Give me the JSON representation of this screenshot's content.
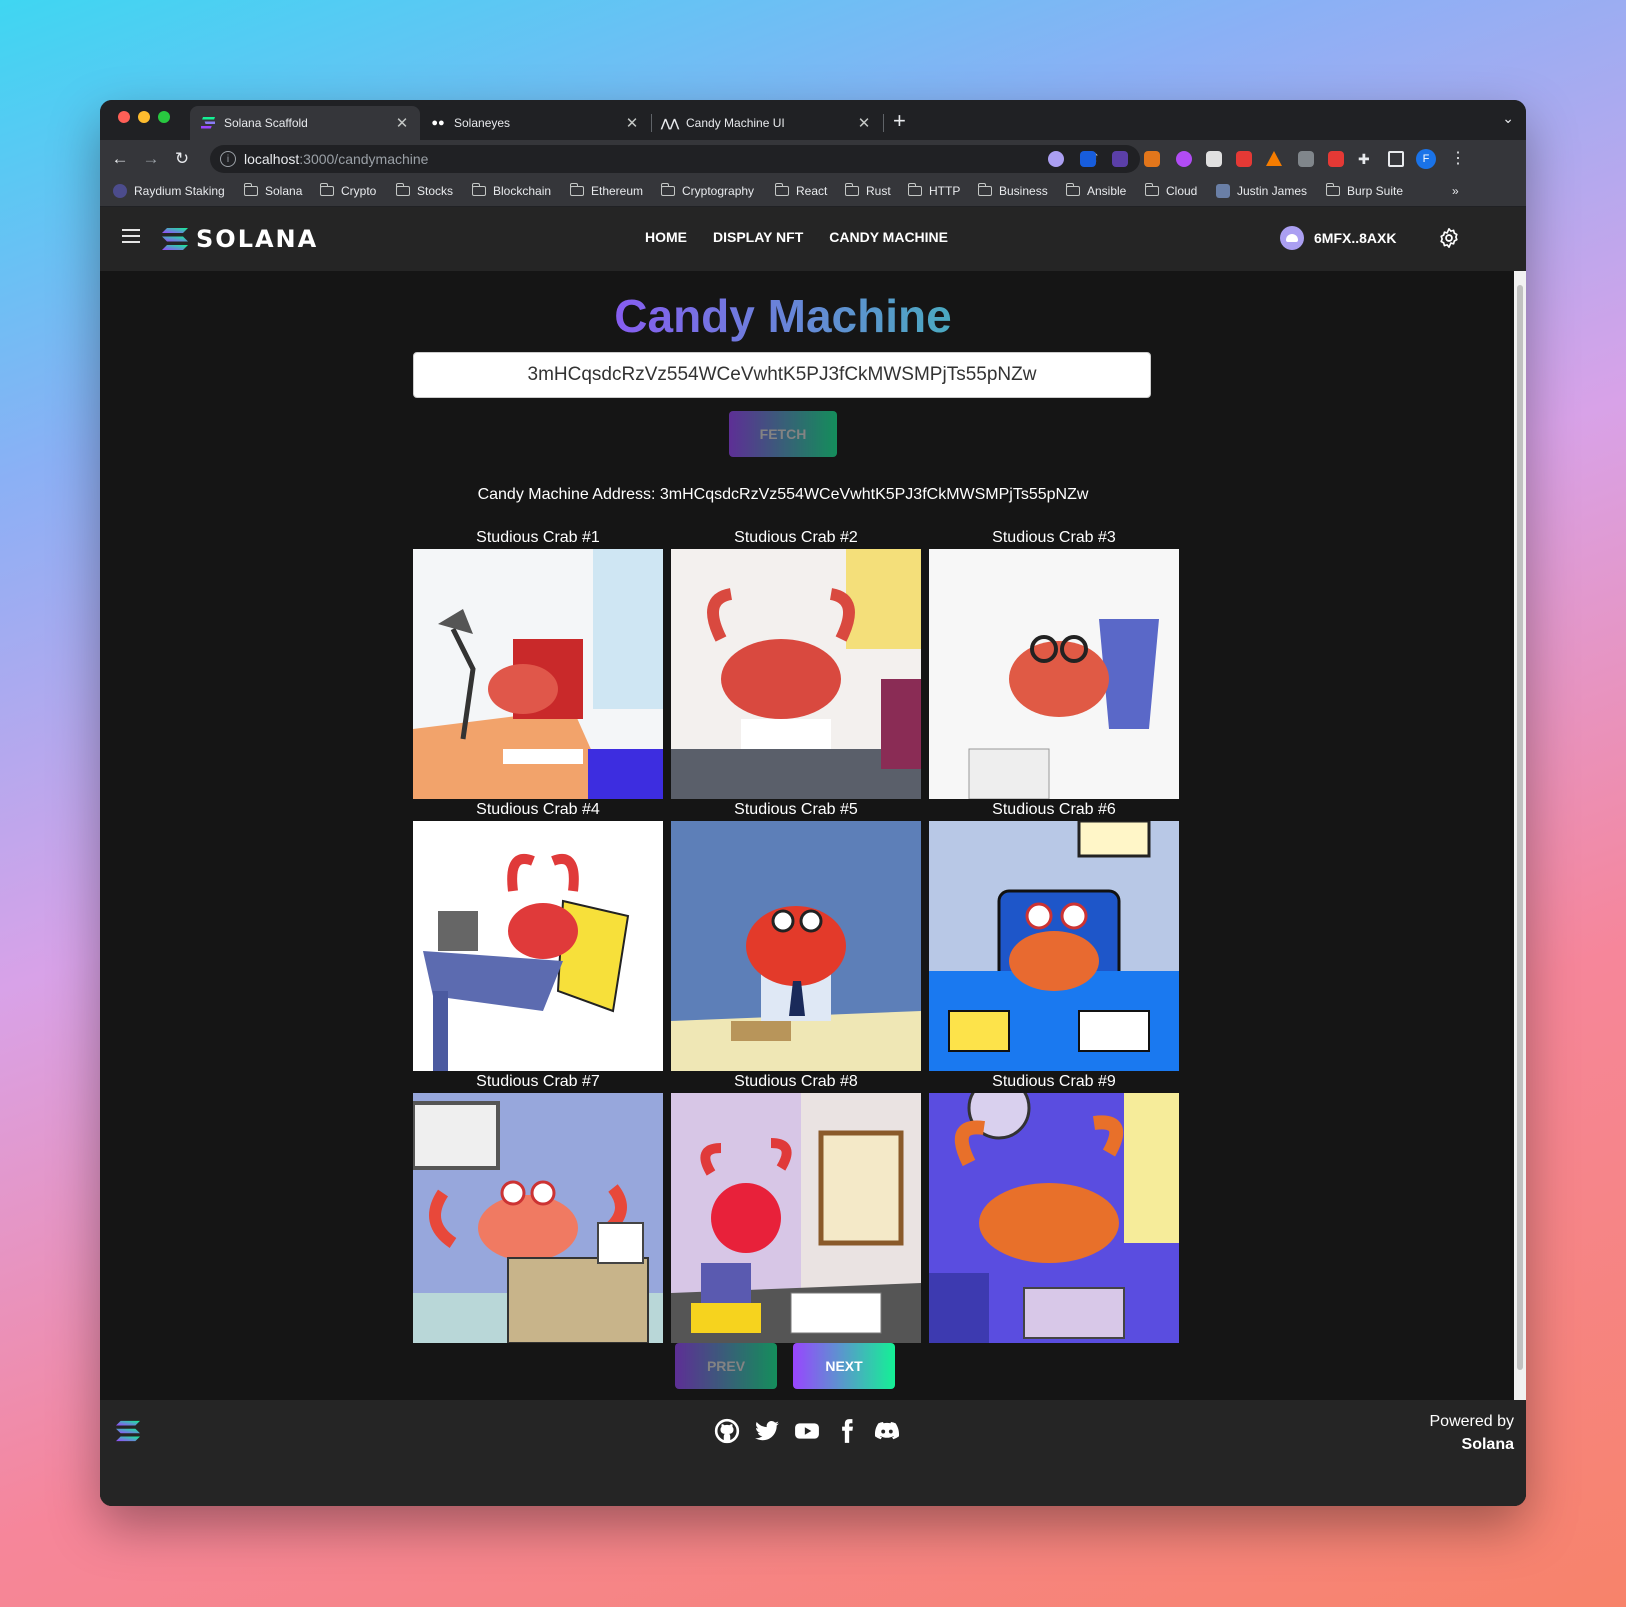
{
  "browser": {
    "tabs": [
      {
        "title": "Solana Scaffold",
        "active": true
      },
      {
        "title": "Solaneyes",
        "active": false
      },
      {
        "title": "Candy Machine UI",
        "active": false
      }
    ],
    "url_host": "localhost",
    "url_path": ":3000/candymachine",
    "profile_initial": "F",
    "bookmarks": [
      "Raydium Staking",
      "Solana",
      "Crypto",
      "Stocks",
      "Blockchain",
      "Ethereum",
      "Cryptography",
      "React",
      "Rust",
      "HTTP",
      "Business",
      "Ansible",
      "Cloud",
      "Justin James",
      "Burp Suite"
    ],
    "bookmarks_overflow": "»"
  },
  "app": {
    "logo_text": "SOLANA",
    "nav": [
      "HOME",
      "DISPLAY NFT",
      "CANDY MACHINE"
    ],
    "wallet_label": "6MFX..8AXK",
    "title": "Candy Machine",
    "address_input_value": "3mHCqsdcRzVz554WCeVwhtK5PJ3fCkMWSMPjTs55pNZw",
    "fetch_label": "FETCH",
    "address_label": "Candy Machine Address: 3mHCqsdcRzVz554WCeVwhtK5PJ3fCkMWSMPjTs55pNZw",
    "nfts": [
      {
        "name": "Studious Crab #1"
      },
      {
        "name": "Studious Crab #2"
      },
      {
        "name": "Studious Crab #3"
      },
      {
        "name": "Studious Crab #4"
      },
      {
        "name": "Studious Crab #5"
      },
      {
        "name": "Studious Crab #6"
      },
      {
        "name": "Studious Crab #7"
      },
      {
        "name": "Studious Crab #8"
      },
      {
        "name": "Studious Crab #9"
      }
    ],
    "prev_label": "PREV",
    "next_label": "NEXT",
    "footer": {
      "powered_by": "Powered by",
      "powered_name": "Solana",
      "social_icons": [
        "github-icon",
        "twitter-icon",
        "youtube-icon",
        "facebook-icon",
        "discord-icon"
      ]
    }
  },
  "colors": {
    "accent_start": "#9945ff",
    "accent_end": "#14f195",
    "page_bg": "#151515",
    "nav_bg": "#252525"
  }
}
